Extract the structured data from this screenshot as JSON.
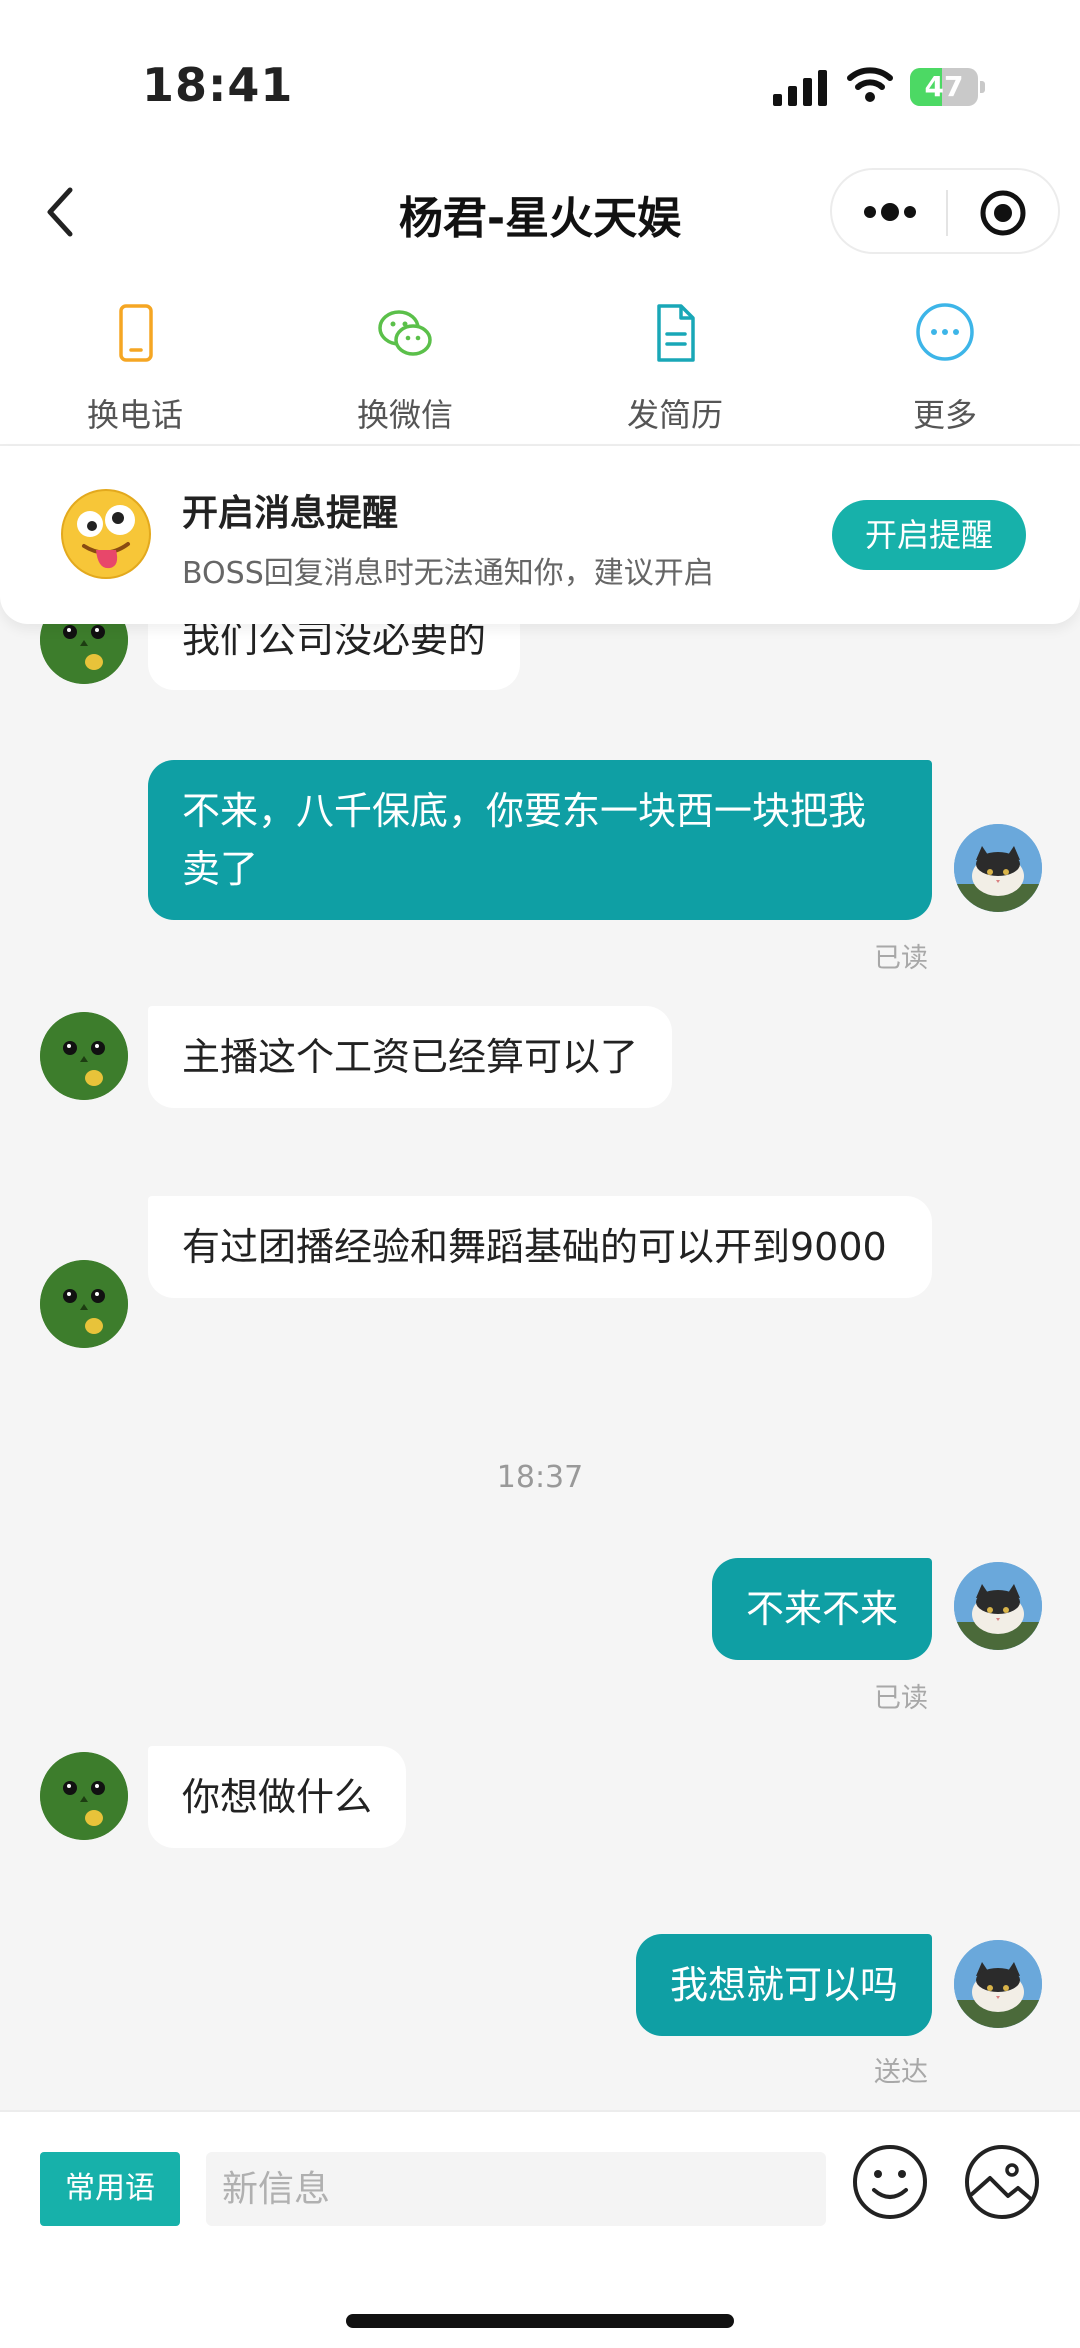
{
  "status_bar": {
    "time": "18:41",
    "battery": "47",
    "battery_level": 0.47
  },
  "nav": {
    "title": "杨君-星火天娱"
  },
  "actions": [
    {
      "label": "换电话",
      "icon": "phone-icon",
      "color": "#f5a623"
    },
    {
      "label": "换微信",
      "icon": "wechat-icon",
      "color": "#5bc04a"
    },
    {
      "label": "发简历",
      "icon": "resume-icon",
      "color": "#19a7b7"
    },
    {
      "label": "更多",
      "icon": "more-dots-icon",
      "color": "#3db5e8"
    }
  ],
  "notify": {
    "title": "开启消息提醒",
    "desc": "BOSS回复消息时无法通知你，建议开启",
    "button": "开启提醒"
  },
  "messages": {
    "m0": {
      "text": "我们公司没必要的"
    },
    "m1": {
      "text": "不来，八千保底，你要东一块西一块把我卖了",
      "receipt": "已读"
    },
    "m2": {
      "text": "主播这个工资已经算可以了"
    },
    "m3": {
      "text": "有过团播经验和舞蹈基础的可以开到9000"
    },
    "time1": "18:37",
    "m4": {
      "text": "不来不来",
      "receipt": "已读"
    },
    "m5": {
      "text": "你想做什么"
    },
    "m6": {
      "text": "我想就可以吗",
      "receipt": "送达"
    }
  },
  "input": {
    "phrases_label": "常用语",
    "placeholder": "新信息"
  },
  "colors": {
    "accent": "#17b1aa",
    "bubble_out": "#0f9fa4"
  }
}
